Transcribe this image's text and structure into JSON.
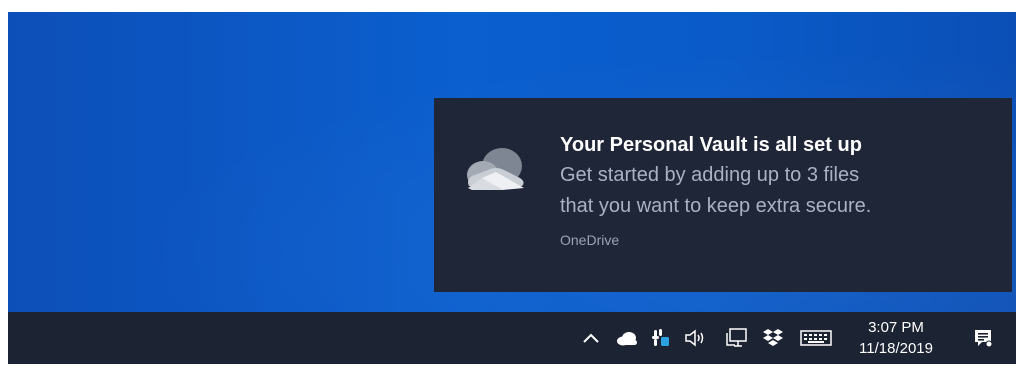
{
  "notification": {
    "title": "Your Personal Vault is all set up",
    "body_line1": "Get started by adding up to 3 files",
    "body_line2": "that you want to keep extra secure.",
    "app_name": "OneDrive",
    "icon": "onedrive-cloud-icon"
  },
  "taskbar": {
    "tray_icons": [
      "chevron-up-icon",
      "onedrive-icon",
      "slack-icon",
      "volume-icon",
      "network-icon",
      "dropbox-icon",
      "keyboard-icon"
    ],
    "time": "3:07 PM",
    "date": "11/18/2019",
    "action_center_icon": "notification-center-icon"
  },
  "colors": {
    "desktop_blue": "#0b5fcf",
    "toast_background": "#1f2637",
    "taskbar_background": "#1c2333",
    "secondary_text": "#a9b2c4"
  }
}
